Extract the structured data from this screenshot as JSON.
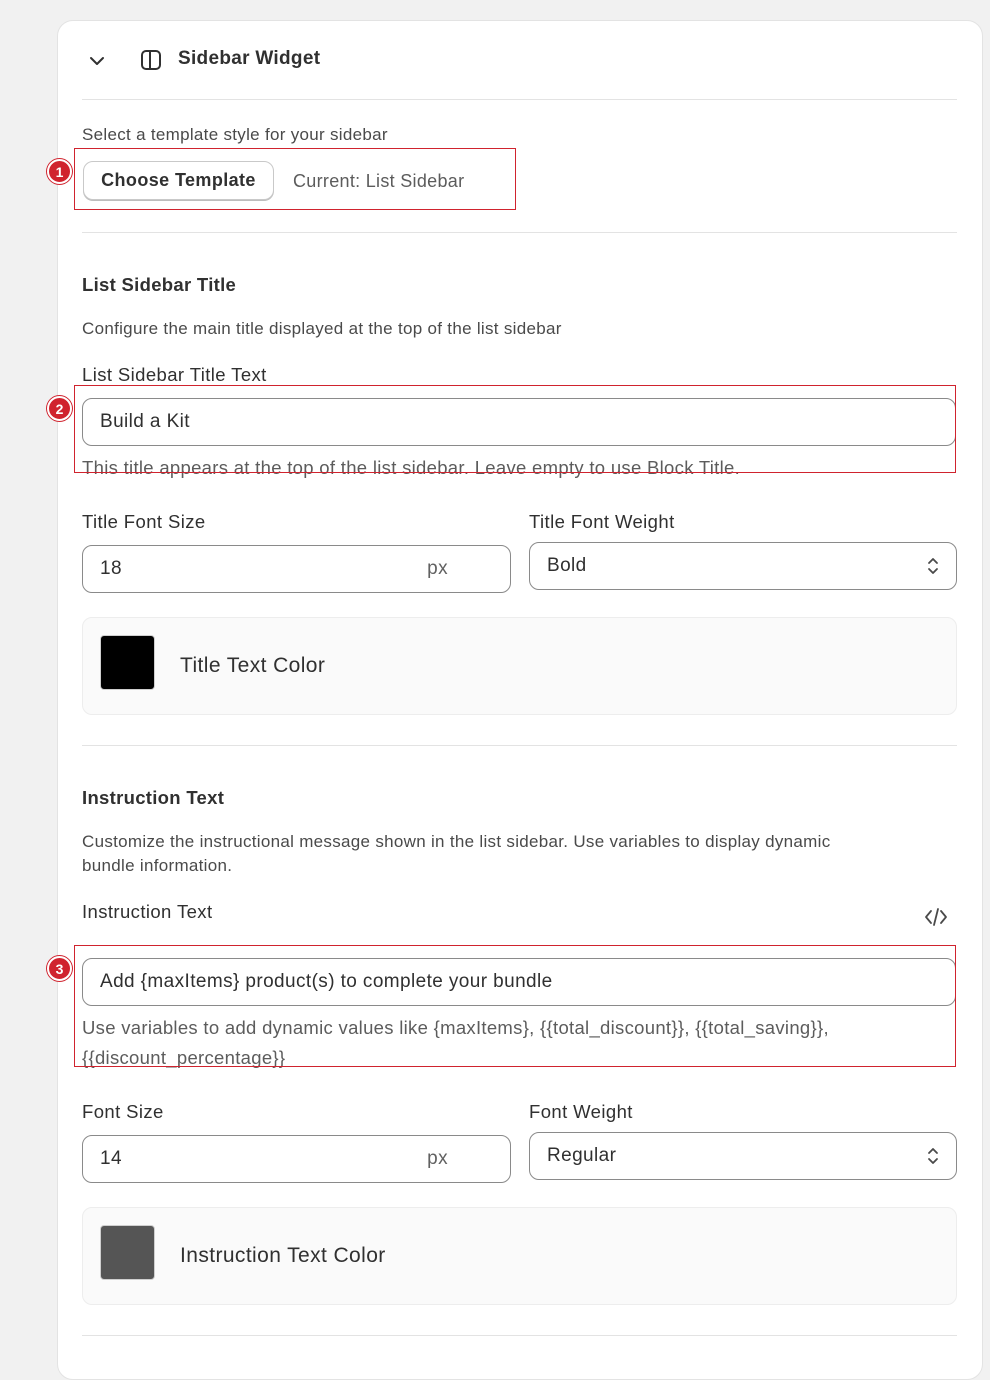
{
  "header": {
    "title": "Sidebar Widget",
    "collapse_icon": "chevron-down-icon",
    "layout_icon": "sidebar-layout-icon"
  },
  "template": {
    "prompt": "Select a template style for your sidebar",
    "button_label": "Choose Template",
    "current": "Current: List Sidebar"
  },
  "title_section": {
    "heading": "List Sidebar Title",
    "description": "Configure the main title displayed at the top of the list sidebar",
    "text_label": "List Sidebar Title Text",
    "text_value": "Build a Kit",
    "help": "This title appears at the top of the list sidebar. Leave empty to use Block Title.",
    "font_size_label": "Title Font Size",
    "font_size_value": "18",
    "font_size_unit": "px",
    "font_weight_label": "Title Font Weight",
    "font_weight_value": "Bold",
    "color_label": "Title Text Color",
    "color_value": "#000000"
  },
  "instruction_section": {
    "heading": "Instruction Text",
    "description_line1": "Customize the instructional message shown in the list sidebar. Use variables to display dynamic",
    "description_line2": "bundle information.",
    "text_label": "Instruction Text",
    "code_icon": "code-icon",
    "text_value": "Add {maxItems} product(s) to complete your bundle",
    "help_line1": "Use variables to add dynamic values like {maxItems}, {{total_discount}}, {{total_saving}},",
    "help_line2": "{{discount_percentage}}",
    "font_size_label": "Font Size",
    "font_size_value": "14",
    "font_size_unit": "px",
    "font_weight_label": "Font Weight",
    "font_weight_value": "Regular",
    "color_label": "Instruction Text Color",
    "color_value": "#555555"
  },
  "annotations": [
    "1",
    "2",
    "3"
  ],
  "colors": {
    "annotation": "#d0232e",
    "panel": "#ffffff",
    "background": "#f1f1f1"
  }
}
